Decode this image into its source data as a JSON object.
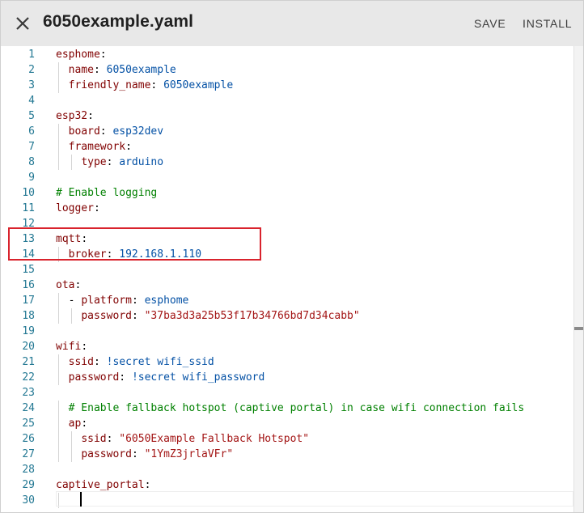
{
  "header": {
    "title": "6050example.yaml",
    "save_label": "SAVE",
    "install_label": "INSTALL",
    "close_icon": "close-icon"
  },
  "editor": {
    "lines": [
      {
        "num": "1",
        "text": "esphome:"
      },
      {
        "num": "2",
        "text": "  name: 6050example"
      },
      {
        "num": "3",
        "text": "  friendly_name: 6050example"
      },
      {
        "num": "4",
        "text": ""
      },
      {
        "num": "5",
        "text": "esp32:"
      },
      {
        "num": "6",
        "text": "  board: esp32dev"
      },
      {
        "num": "7",
        "text": "  framework:"
      },
      {
        "num": "8",
        "text": "    type: arduino"
      },
      {
        "num": "9",
        "text": ""
      },
      {
        "num": "10",
        "text": "# Enable logging"
      },
      {
        "num": "11",
        "text": "logger:"
      },
      {
        "num": "12",
        "text": ""
      },
      {
        "num": "13",
        "text": "mqtt:"
      },
      {
        "num": "14",
        "text": "  broker: 192.168.1.110"
      },
      {
        "num": "15",
        "text": ""
      },
      {
        "num": "16",
        "text": "ota:"
      },
      {
        "num": "17",
        "text": "  - platform: esphome"
      },
      {
        "num": "18",
        "text": "    password: \"37ba3d3a25b53f17b34766bd7d34cabb\""
      },
      {
        "num": "19",
        "text": ""
      },
      {
        "num": "20",
        "text": "wifi:"
      },
      {
        "num": "21",
        "text": "  ssid: !secret wifi_ssid"
      },
      {
        "num": "22",
        "text": "  password: !secret wifi_password"
      },
      {
        "num": "23",
        "text": ""
      },
      {
        "num": "24",
        "text": "  # Enable fallback hotspot (captive portal) in case wifi connection fails"
      },
      {
        "num": "25",
        "text": "  ap:"
      },
      {
        "num": "26",
        "text": "    ssid: \"6050Example Fallback Hotspot\""
      },
      {
        "num": "27",
        "text": "    password: \"1YmZ3jrlaVFr\""
      },
      {
        "num": "28",
        "text": ""
      },
      {
        "num": "29",
        "text": "captive_portal:"
      },
      {
        "num": "30",
        "text": "  "
      }
    ]
  },
  "colors": {
    "key": "#800000",
    "comment": "#008000",
    "string": "#a31515",
    "value": "#0451a5",
    "line_number": "#237893",
    "highlight": "#d9232d"
  }
}
